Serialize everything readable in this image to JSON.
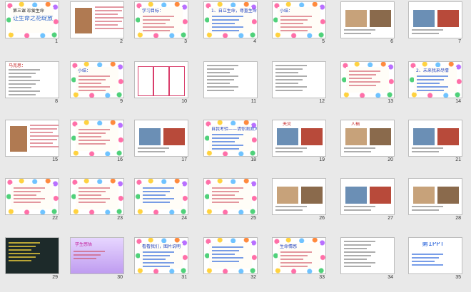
{
  "slides": [
    {
      "n": "1",
      "style": "flower",
      "title": "让生命之花绽放",
      "sub": "第三课 珍爱生命"
    },
    {
      "n": "2",
      "style": "photo-text"
    },
    {
      "n": "3",
      "style": "flower-text",
      "title": "学习目标："
    },
    {
      "n": "4",
      "style": "flower-lines",
      "title": "1、自立生命，尊重生命"
    },
    {
      "n": "5",
      "style": "flower-text",
      "title": "小结："
    },
    {
      "n": "6",
      "style": "photos"
    },
    {
      "n": "7",
      "style": "photos"
    },
    {
      "n": "8",
      "style": "text-white",
      "title": "马克思："
    },
    {
      "n": "9",
      "style": "flower-text",
      "title": "小结："
    },
    {
      "n": "10",
      "style": "boxes"
    },
    {
      "n": "11",
      "style": "text-white"
    },
    {
      "n": "12",
      "style": "text-white"
    },
    {
      "n": "13",
      "style": "flower-text"
    },
    {
      "n": "14",
      "style": "flower-lines",
      "title": "2、未来我来尽情"
    },
    {
      "n": "15",
      "style": "photo-text"
    },
    {
      "n": "16",
      "style": "flower-text"
    },
    {
      "n": "17",
      "style": "photos"
    },
    {
      "n": "18",
      "style": "flower-lines",
      "title": "自我考验——请你测测大班级"
    },
    {
      "n": "19",
      "style": "photos",
      "title": "天灾"
    },
    {
      "n": "20",
      "style": "photos",
      "title": "人祸"
    },
    {
      "n": "21",
      "style": "photos"
    },
    {
      "n": "22",
      "style": "flower-text"
    },
    {
      "n": "23",
      "style": "flower-text"
    },
    {
      "n": "24",
      "style": "flower-lines"
    },
    {
      "n": "25",
      "style": "flower-text"
    },
    {
      "n": "26",
      "style": "photos"
    },
    {
      "n": "27",
      "style": "photos"
    },
    {
      "n": "28",
      "style": "photos"
    },
    {
      "n": "29",
      "style": "dark"
    },
    {
      "n": "30",
      "style": "purple",
      "title": "学生感悟"
    },
    {
      "n": "31",
      "style": "flower-lines",
      "title": "看看我们，图片说明"
    },
    {
      "n": "32",
      "style": "flower-lines"
    },
    {
      "n": "33",
      "style": "flower-text",
      "title": "生命情感"
    },
    {
      "n": "34",
      "style": "text-white"
    },
    {
      "n": "35",
      "style": "logo",
      "title": "第1PPT"
    }
  ]
}
